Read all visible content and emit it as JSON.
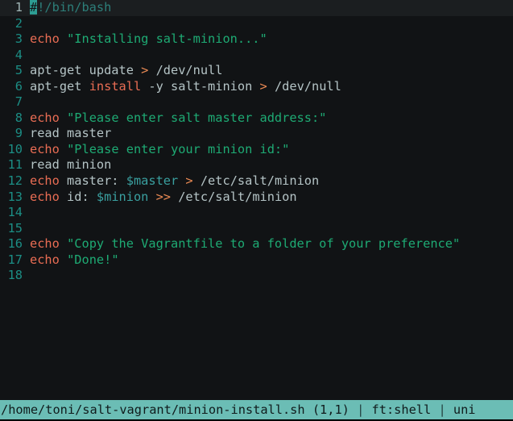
{
  "app": {
    "name": "vim",
    "background": "#111315",
    "cursorline_background": "#1b1e20",
    "linenumber_color": "#1c8e85",
    "current_linenumber_color": "#9fb4b4",
    "cursor_block_color": "#2d9d93",
    "status_background": "#6bbdb5",
    "status_foreground": "#101b1c"
  },
  "colors": {
    "keyword": "#ea6d54",
    "string": "#1eab74",
    "variable": "#3aa0a0",
    "operator": "#ea8a54",
    "comment": "#2d7f7a",
    "plain": "#b5c4c6"
  },
  "editor": {
    "lines": [
      {
        "number": "1",
        "current": true,
        "tokens": [
          {
            "text": "#",
            "cls": "cursor-block"
          },
          {
            "text": "!/bin/bash",
            "cls": "t-cmt"
          }
        ]
      },
      {
        "number": "2",
        "current": false,
        "tokens": []
      },
      {
        "number": "3",
        "current": false,
        "tokens": [
          {
            "text": "echo",
            "cls": "t-kw"
          },
          {
            "text": " ",
            "cls": "t-pln"
          },
          {
            "text": "\"Installing salt-minion...\"",
            "cls": "t-str"
          }
        ]
      },
      {
        "number": "4",
        "current": false,
        "tokens": []
      },
      {
        "number": "5",
        "current": false,
        "tokens": [
          {
            "text": "apt-get update ",
            "cls": "t-pln"
          },
          {
            "text": ">",
            "cls": "t-op"
          },
          {
            "text": " /dev/null",
            "cls": "t-path"
          }
        ]
      },
      {
        "number": "6",
        "current": false,
        "tokens": [
          {
            "text": "apt-get ",
            "cls": "t-pln"
          },
          {
            "text": "install",
            "cls": "t-kw"
          },
          {
            "text": " -y salt-minion ",
            "cls": "t-pln"
          },
          {
            "text": ">",
            "cls": "t-op"
          },
          {
            "text": " /dev/null",
            "cls": "t-path"
          }
        ]
      },
      {
        "number": "7",
        "current": false,
        "tokens": []
      },
      {
        "number": "8",
        "current": false,
        "tokens": [
          {
            "text": "echo",
            "cls": "t-kw"
          },
          {
            "text": " ",
            "cls": "t-pln"
          },
          {
            "text": "\"Please enter salt master address:\"",
            "cls": "t-str"
          }
        ]
      },
      {
        "number": "9",
        "current": false,
        "tokens": [
          {
            "text": "read master",
            "cls": "t-pln"
          }
        ]
      },
      {
        "number": "10",
        "current": false,
        "tokens": [
          {
            "text": "echo",
            "cls": "t-kw"
          },
          {
            "text": " ",
            "cls": "t-pln"
          },
          {
            "text": "\"Please enter your minion id:\"",
            "cls": "t-str"
          }
        ]
      },
      {
        "number": "11",
        "current": false,
        "tokens": [
          {
            "text": "read minion",
            "cls": "t-pln"
          }
        ]
      },
      {
        "number": "12",
        "current": false,
        "tokens": [
          {
            "text": "echo",
            "cls": "t-kw"
          },
          {
            "text": " master: ",
            "cls": "t-pln"
          },
          {
            "text": "$master",
            "cls": "t-var"
          },
          {
            "text": " ",
            "cls": "t-pln"
          },
          {
            "text": ">",
            "cls": "t-op"
          },
          {
            "text": " /etc/salt/minion",
            "cls": "t-path"
          }
        ]
      },
      {
        "number": "13",
        "current": false,
        "tokens": [
          {
            "text": "echo",
            "cls": "t-kw"
          },
          {
            "text": " id: ",
            "cls": "t-pln"
          },
          {
            "text": "$minion",
            "cls": "t-var"
          },
          {
            "text": " ",
            "cls": "t-pln"
          },
          {
            "text": ">>",
            "cls": "t-op"
          },
          {
            "text": " /etc/salt/minion",
            "cls": "t-path"
          }
        ]
      },
      {
        "number": "14",
        "current": false,
        "tokens": []
      },
      {
        "number": "15",
        "current": false,
        "tokens": []
      },
      {
        "number": "16",
        "current": false,
        "tokens": [
          {
            "text": "echo",
            "cls": "t-kw"
          },
          {
            "text": " ",
            "cls": "t-pln"
          },
          {
            "text": "\"Copy the Vagrantfile to a folder of your preference\"",
            "cls": "t-str"
          }
        ]
      },
      {
        "number": "17",
        "current": false,
        "tokens": [
          {
            "text": "echo",
            "cls": "t-kw"
          },
          {
            "text": " ",
            "cls": "t-pln"
          },
          {
            "text": "\"Done!\"",
            "cls": "t-str"
          }
        ]
      },
      {
        "number": "18",
        "current": false,
        "tokens": []
      }
    ]
  },
  "status": {
    "file_path": "/home/toni/salt-vagrant/minion-install.sh",
    "cursor_position": "(1,1)",
    "filetype": "ft:shell",
    "fileformat": "uni",
    "separator": "|",
    "full_text": "/home/toni/salt-vagrant/minion-install.sh (1,1) | ft:shell | uni"
  }
}
